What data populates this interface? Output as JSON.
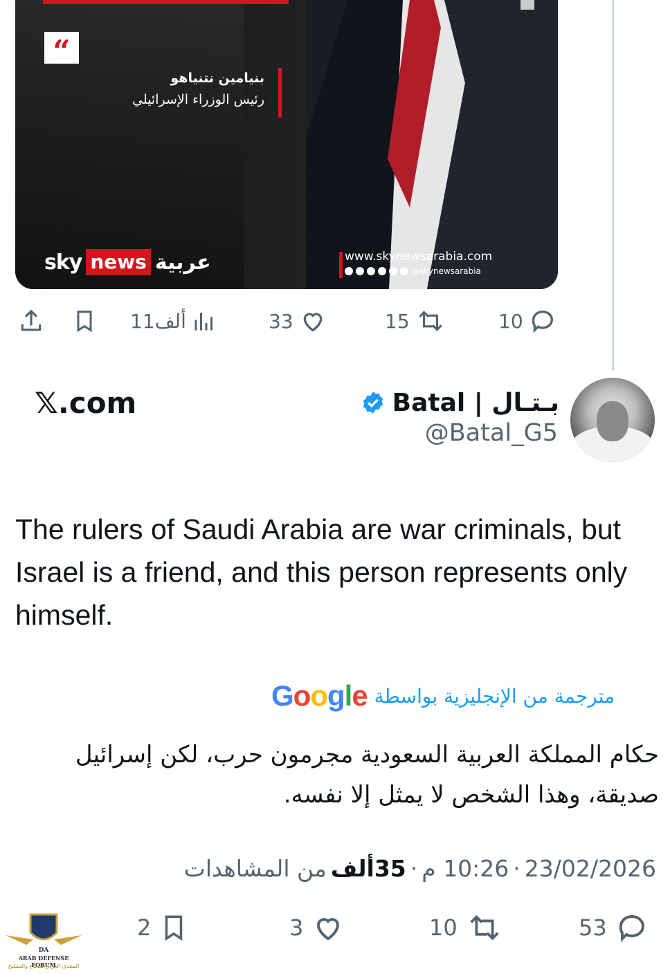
{
  "quoted_media": {
    "speaker_name": "بنيامين نتنياهو",
    "speaker_role": "رئيس الوزراء الإسرائيلي",
    "brand_sky": "sky",
    "brand_news": "news",
    "brand_arabic": "عربية",
    "site_url": "www.skynewsarabia.com",
    "social_handle": "@skynewsarabia"
  },
  "quoted_actions": {
    "replies": "10",
    "reposts": "15",
    "likes": "33",
    "views": "11ألف"
  },
  "tweet": {
    "display_name": "Batal | بـتـال",
    "handle": "@Batal_G5",
    "source_label": "𝕏.com",
    "text": "The rulers of Saudi Arabia are war criminals, but Israel is a friend, and this person represents only himself.",
    "translated_label": "مترجمة من الإنجليزية بواسطة",
    "translation": "حكام المملكة العربية السعودية مجرمون حرب، لكن إسرائيل صديقة، وهذا الشخص لا يمثل إلا نفسه.",
    "date": "23/02/2026",
    "time": "10:26 م",
    "views_count": "35ألف",
    "views_label": "من المشاهدات"
  },
  "main_actions": {
    "replies": "53",
    "reposts": "10",
    "likes": "3",
    "bookmarks": "2"
  },
  "watermark": {
    "title": "ARAB DEFENSE FORUM",
    "subtitle": "المنتدى العربي للدفاع والتسليح",
    "logo_letters": "DA"
  },
  "colors": {
    "accent": "#1d9bf0",
    "secondary_text": "#536471",
    "sky_red": "#d3161d"
  }
}
